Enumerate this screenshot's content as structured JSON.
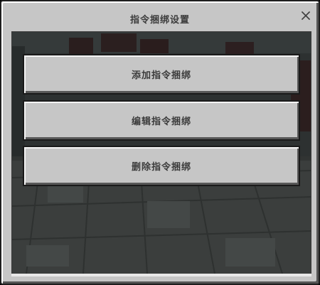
{
  "dialog": {
    "title": "指令捆绑设置",
    "close_icon": "close-x-icon"
  },
  "buttons": [
    {
      "label": "添加指令捆绑"
    },
    {
      "label": "编辑指令捆绑"
    },
    {
      "label": "删除指令捆绑"
    }
  ],
  "colors": {
    "panel": "#c6c6c6",
    "button_face": "#c6c6c6",
    "text": "#3c3c3c",
    "border_dark": "#1a1a1a"
  }
}
